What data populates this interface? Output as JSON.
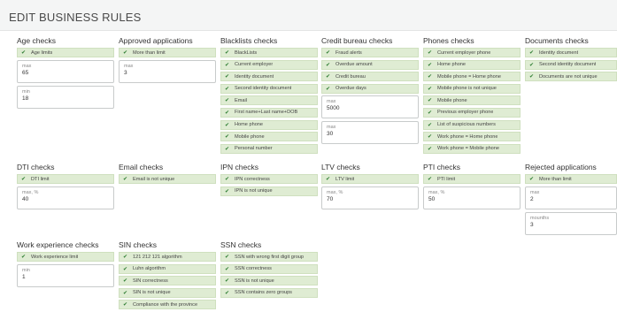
{
  "page": {
    "title": "EDIT BUSINESS RULES"
  },
  "groups": {
    "age": {
      "title": "Age checks",
      "rules": [
        "Age limits"
      ],
      "fields": [
        {
          "label": "max",
          "value": "65"
        },
        {
          "label": "min",
          "value": "18"
        }
      ]
    },
    "approved": {
      "title": "Approved applications",
      "rules": [
        "More than limit"
      ],
      "fields": [
        {
          "label": "max",
          "value": "3"
        }
      ]
    },
    "blacklists": {
      "title": "Blacklists checks",
      "rules": [
        "BlackLists",
        "Current employer",
        "Identity document",
        "Second identity document",
        "Email",
        "First name+Last name+DOB",
        "Home phone",
        "Mobile phone",
        "Personal number"
      ]
    },
    "credit": {
      "title": "Credit bureau checks",
      "rules": [
        "Fraud alerts",
        "Overdue amount",
        "Credit bureau",
        "Overdue days"
      ],
      "fields": [
        {
          "label": "max",
          "value": "5000"
        },
        {
          "label": "max",
          "value": "30"
        }
      ]
    },
    "phones": {
      "title": "Phones checks",
      "rules": [
        "Current employer phone",
        "Home phone",
        "Mobile phone = Home phone",
        "Mobile phone is not unique",
        "Mobile phone",
        "Previous employer phone",
        "List of suspicious numbers",
        "Work phone = Home phone",
        "Work phone = Mobile phone"
      ]
    },
    "documents": {
      "title": "Documents checks",
      "rules": [
        "Identity document",
        "Second identity document",
        "Documents are not unique"
      ]
    },
    "dti": {
      "title": "DTI checks",
      "rules": [
        "DTI limit"
      ],
      "fields": [
        {
          "label": "max, %",
          "value": "40"
        }
      ]
    },
    "email": {
      "title": "Email checks",
      "rules": [
        "Email is not unique"
      ]
    },
    "ipn": {
      "title": "IPN checks",
      "rules": [
        "IPN correctness",
        "IPN is not unique"
      ]
    },
    "ltv": {
      "title": "LTV checks",
      "rules": [
        "LTV limit"
      ],
      "fields": [
        {
          "label": "max, %",
          "value": "70"
        }
      ]
    },
    "pti": {
      "title": "PTI checks",
      "rules": [
        "PTI limit"
      ],
      "fields": [
        {
          "label": "max, %",
          "value": "50"
        }
      ]
    },
    "rejected": {
      "title": "Rejected applications",
      "rules": [
        "More than limit"
      ],
      "fields": [
        {
          "label": "max",
          "value": "2"
        },
        {
          "label": "mounths",
          "value": "3"
        }
      ]
    },
    "work": {
      "title": "Work experience checks",
      "rules": [
        "Work experience limit"
      ],
      "fields": [
        {
          "label": "min",
          "value": "1"
        }
      ]
    },
    "sin": {
      "title": "SIN checks",
      "rules": [
        "121 212 121 algorithm",
        "Luhn algorithm",
        "SIN correctness",
        "SIN is not unique",
        "Compliance with the province"
      ]
    },
    "ssn": {
      "title": "SSN checks",
      "rules": [
        "SSN with wrong first digit group",
        "SSN correctness",
        "SSN is not unique",
        "SSN contains zero groups"
      ]
    }
  },
  "colors": {
    "checked_bg": "#dfecd3",
    "check_mark": "#2e7d32"
  },
  "icons": {
    "checkbox": "check-icon"
  }
}
